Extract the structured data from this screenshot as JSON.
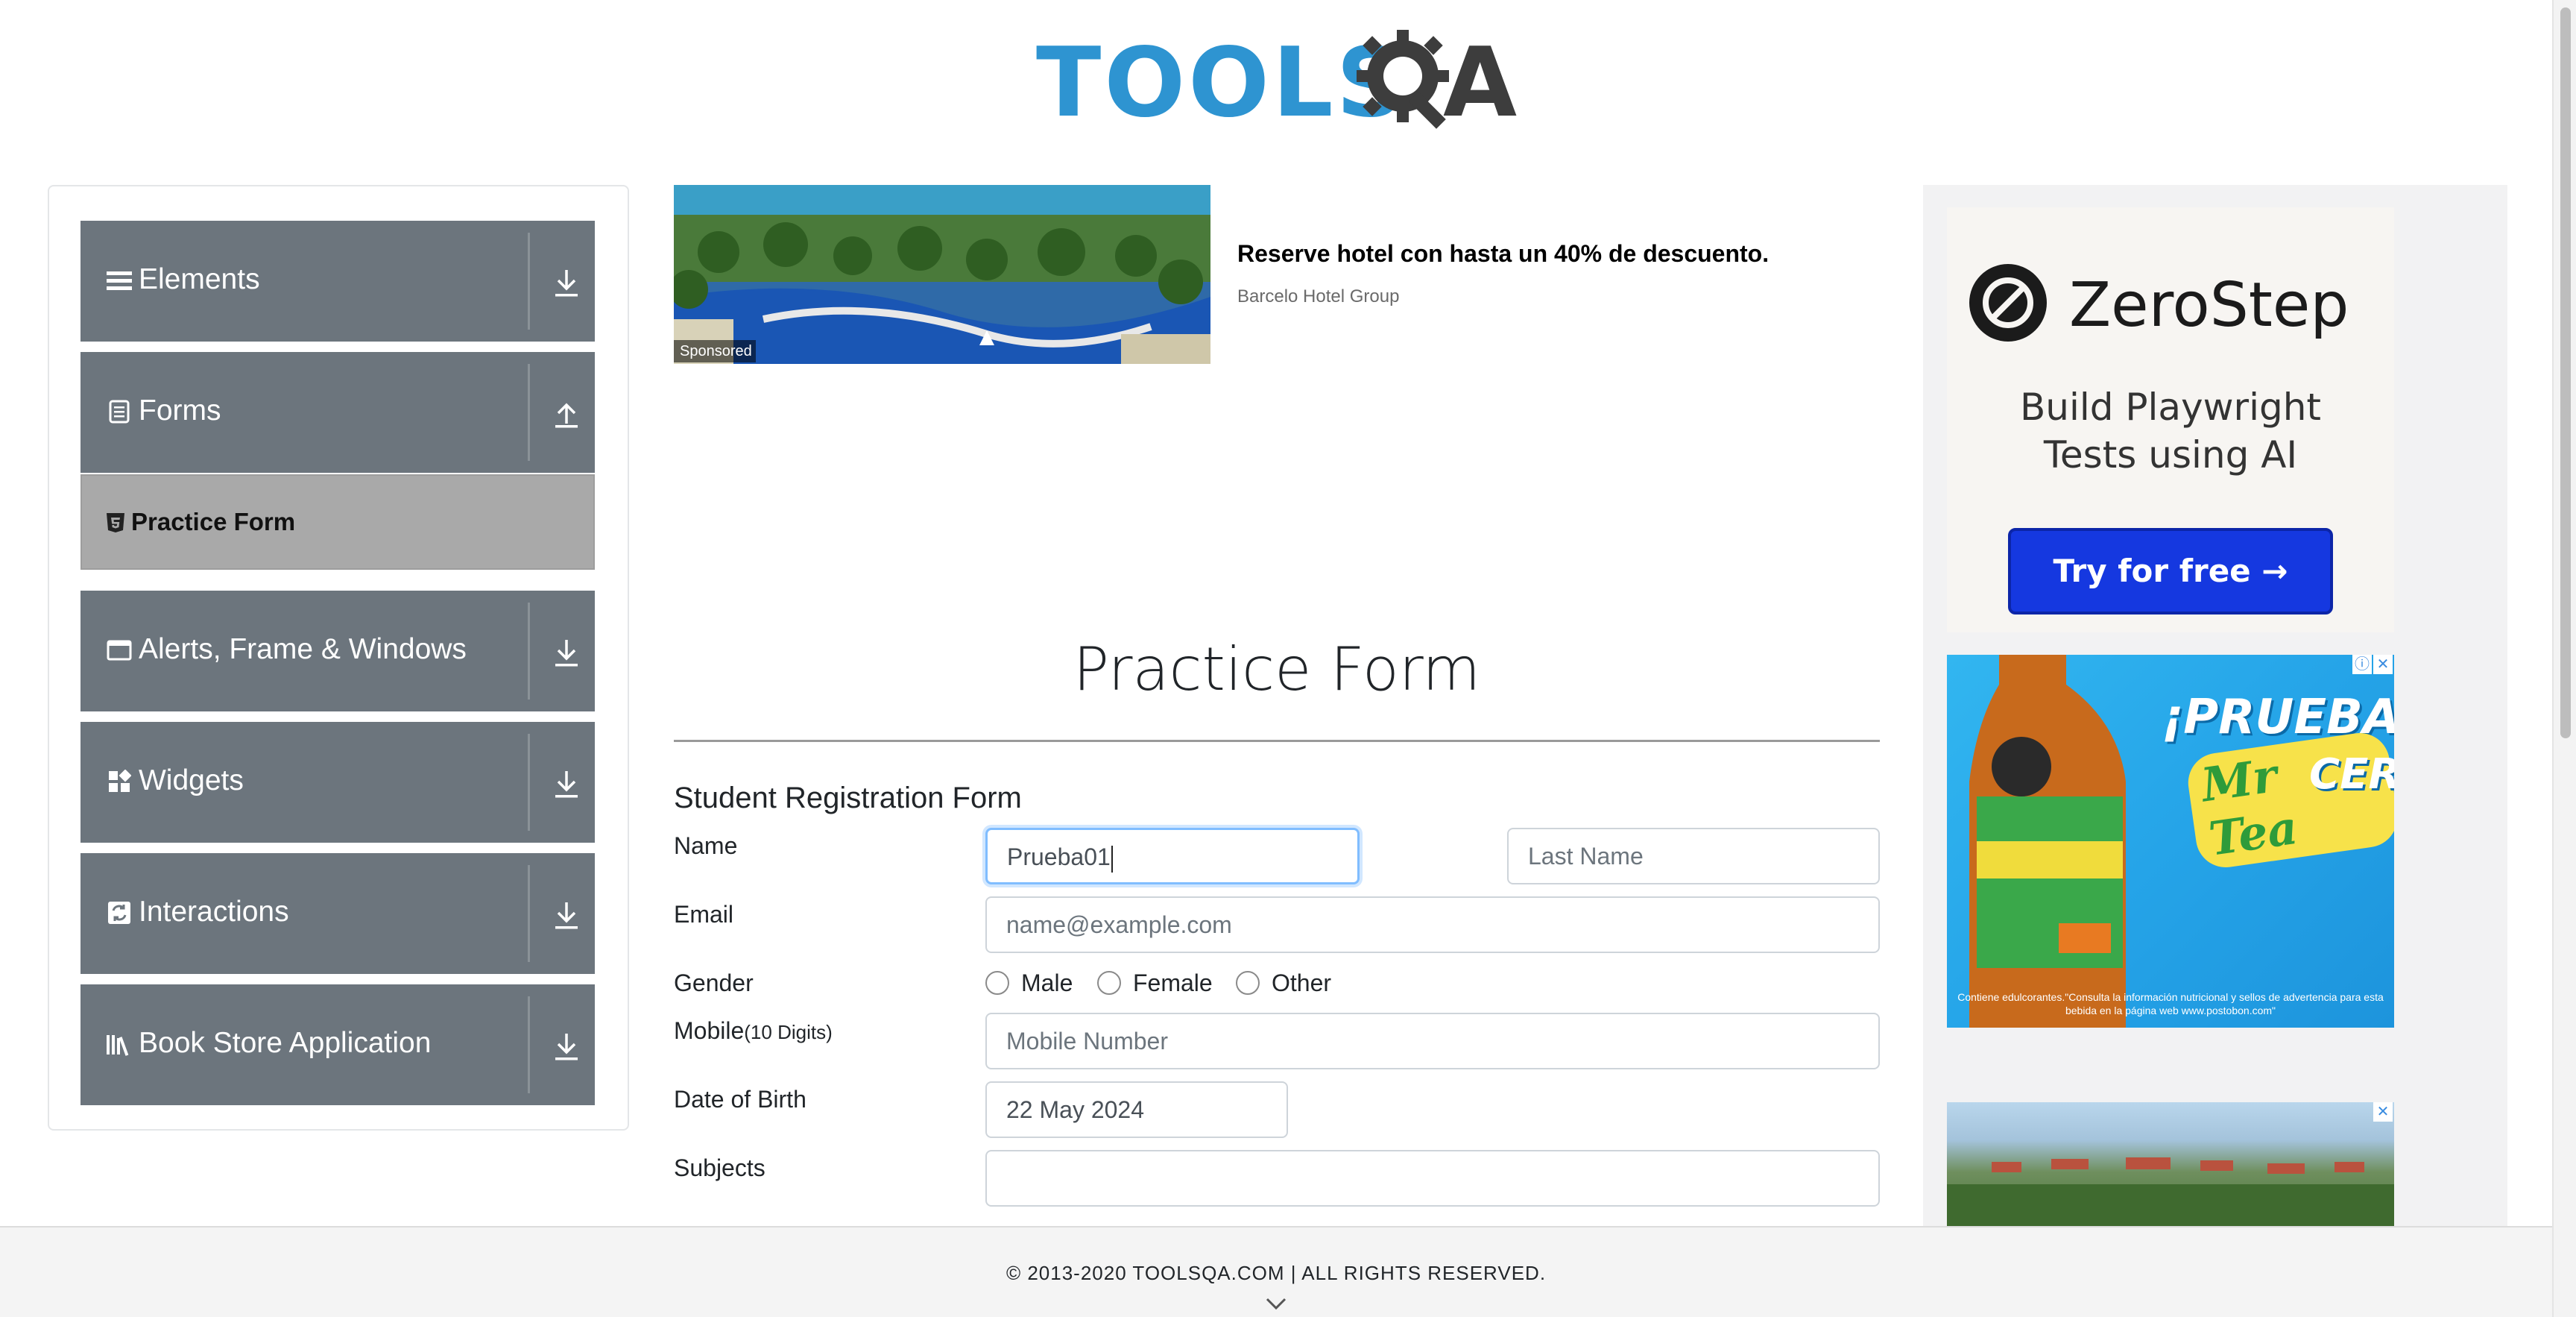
{
  "logo": {
    "text": "TOOLS",
    "text_accent": "A",
    "alt": "TOOLSQA"
  },
  "sidebar": {
    "groups": [
      {
        "label": "Elements",
        "icon": "list-icon",
        "state": "collapsed"
      },
      {
        "label": "Forms",
        "icon": "form-icon",
        "state": "expanded"
      },
      {
        "label": "Alerts, Frame & Windows",
        "icon": "window-icon",
        "state": "collapsed"
      },
      {
        "label": "Widgets",
        "icon": "widgets-icon",
        "state": "collapsed"
      },
      {
        "label": "Interactions",
        "icon": "interactions-icon",
        "state": "collapsed"
      },
      {
        "label": "Book Store Application",
        "icon": "library-icon",
        "state": "collapsed"
      }
    ],
    "active_item": "Practice Form"
  },
  "ad_top": {
    "title": "Reserve hotel con hasta un 40% de descuento.",
    "advertiser": "Barcelo Hotel Group",
    "sponsored_label": "Sponsored"
  },
  "page": {
    "title": "Practice Form",
    "form_heading": "Student Registration Form"
  },
  "form": {
    "name_label": "Name",
    "first_name_value": "Prueba01",
    "last_name_placeholder": "Last Name",
    "email_label": "Email",
    "email_placeholder": "name@example.com",
    "gender_label": "Gender",
    "gender_options": [
      "Male",
      "Female",
      "Other"
    ],
    "mobile_label": "Mobile",
    "mobile_hint": "(10 Digits)",
    "mobile_placeholder": "Mobile Number",
    "dob_label": "Date of Birth",
    "dob_value": "22 May 2024",
    "subjects_label": "Subjects",
    "subjects_value": ""
  },
  "right_ads": {
    "zerostep": {
      "brand": "ZeroStep",
      "tagline_line1": "Build Playwright",
      "tagline_line2": "Tests using AI",
      "cta": "Try for free →"
    },
    "tea": {
      "headline": "¡PRUEBA UN",
      "brand": "Mr Tea",
      "suffix": "CERO",
      "fine_print": "Contiene edulcorantes.\"Consulta la información nutricional y sellos de advertencia para esta bebida en la página web www.postobon.com\""
    }
  },
  "footer": {
    "copyright": "© 2013-2020 TOOLSQA.COM | ALL RIGHTS RESERVED."
  },
  "colors": {
    "sidebar_group_bg": "#6c757d",
    "sidebar_active_bg": "#a9a9a9",
    "logo_blue": "#2e94d1",
    "focus_border": "#80bdff",
    "zerostep_button": "#1538e0"
  }
}
